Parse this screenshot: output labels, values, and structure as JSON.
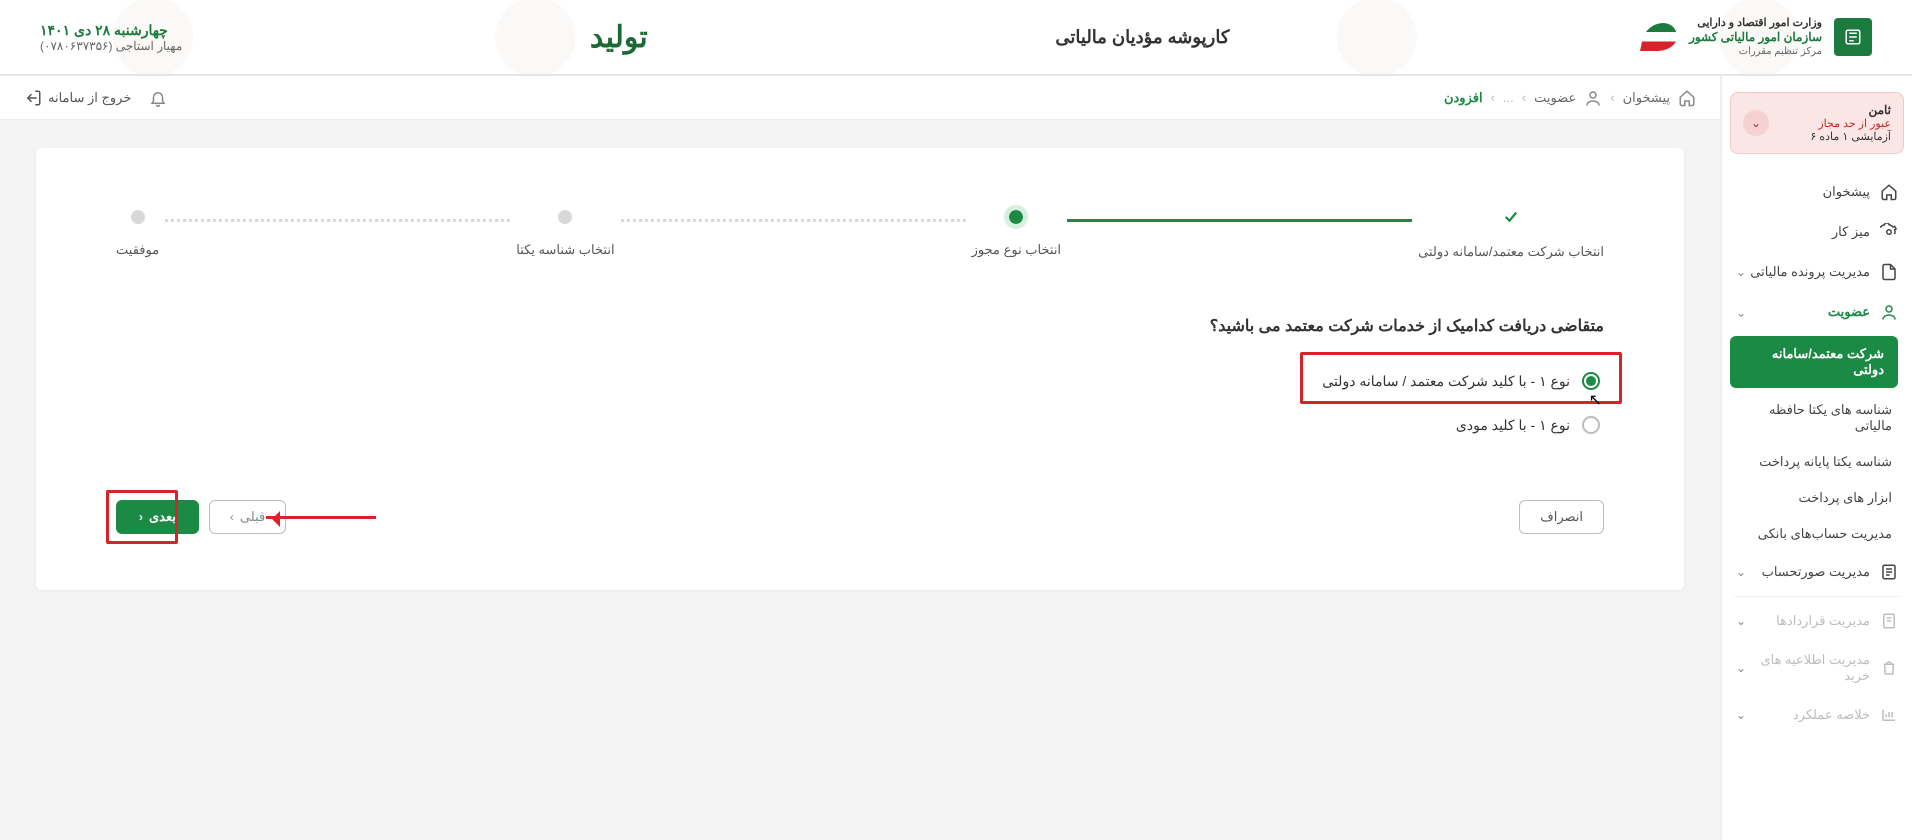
{
  "header": {
    "org_line1": "وزارت امور اقتصاد و دارایی",
    "org_line2": "سازمان امور مالیاتی کشور",
    "org_line3": "مرکز تنظیم مقررات",
    "app_title": "کارپوشه مؤدیان مالیاتی",
    "logo_word": "تولید",
    "date": "چهارشنبه ۲۸ دی ۱۴۰۱",
    "user": "مهیار استاجی (۰۷۸۰۶۳۷۳۵۶)"
  },
  "alert": {
    "title": "ثامن",
    "status": "عبور از حد مجاز",
    "sub": "آزمایشی ۱   ماده ۶"
  },
  "sidebar": {
    "dashboard": "پیشخوان",
    "desk": "میز کار",
    "docs": "مدیریت پرونده مالیاتی",
    "membership": "عضویت",
    "membership_children": {
      "trusted": "شرکت معتمد/سامانه دولتی",
      "uids": "شناسه های یکتا حافظه مالیاتی",
      "payuid": "شناسه یکتا پایانه پرداخت",
      "paytools": "ابزار های پرداخت",
      "bank": "مدیریت حساب‌های بانکی"
    },
    "invoice": "مدیریت صورتحساب",
    "contracts": "مدیریت قراردادها",
    "purchase": "مدیریت اطلاعیه های خرید",
    "summary": "خلاصه عملکرد"
  },
  "mainbar": {
    "home": "پیشخوان",
    "level2": "عضویت",
    "dots": "...",
    "add": "افزودن",
    "logout": "خروج از سامانه"
  },
  "stepper": {
    "s1": "انتخاب شرکت معتمد/سامانه دولتی",
    "s2": "انتخاب نوع مجوز",
    "s3": "انتخاب شناسه یکتا",
    "s4": "موفقیت"
  },
  "form": {
    "question": "متقاضی دریافت کدامیک از خدمات شرکت معتمد می باشید؟",
    "opt1": "نوع ۱ - با کلید شرکت معتمد / سامانه دولتی",
    "opt2": "نوع ۱ - با کلید مودی",
    "cancel": "انصراف",
    "prev": "قبلی",
    "next": "بعدی"
  },
  "colors": {
    "primary": "#1b8a45",
    "danger": "#d8232a"
  }
}
